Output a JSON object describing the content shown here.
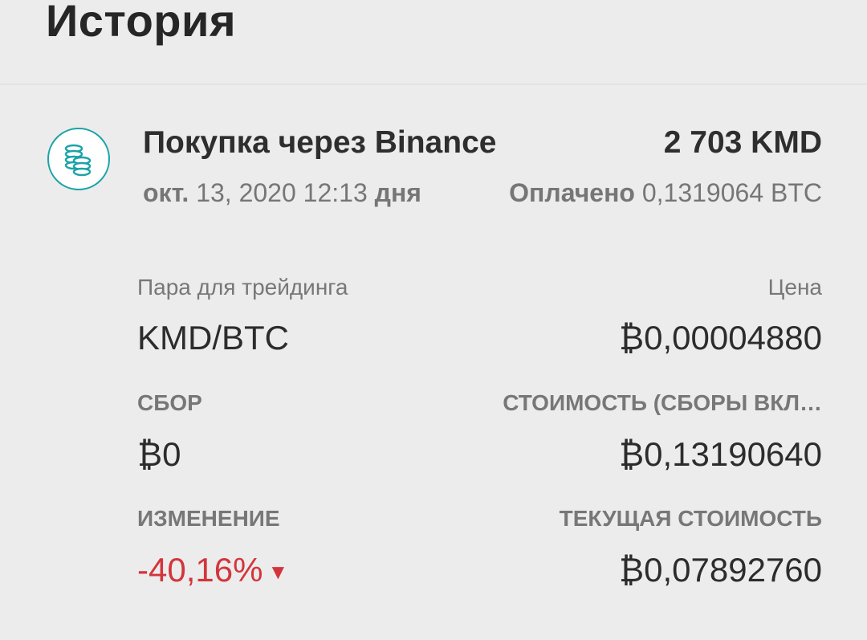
{
  "header": {
    "title": "История"
  },
  "transaction": {
    "icon": "coins-icon",
    "title": "Покупка через Binance",
    "amount": "2 703 KMD",
    "date_month": "окт.",
    "date_rest": "13, 2020 12:13",
    "date_period": "дня",
    "paid_label": "Оплачено",
    "paid_value": "0,1319064 BTC"
  },
  "details": {
    "pair_label": "Пара для трейдинга",
    "pair_value": "KMD/BTC",
    "price_label": "Цена",
    "price_value": "₿0,00004880",
    "fee_label": "СБОР",
    "fee_value": "₿0",
    "cost_label": "СТОИМОСТЬ (СБОРЫ ВКЛ…",
    "cost_value": "₿0,13190640",
    "change_label": "ИЗМЕНЕНИЕ",
    "change_value": "-40,16%",
    "change_arrow": "▼",
    "current_label": "ТЕКУЩАЯ СТОИМОСТЬ",
    "current_value": "₿0,07892760"
  },
  "colors": {
    "accent": "#1aa3a8",
    "negative": "#d3353b",
    "background": "#ececec"
  }
}
